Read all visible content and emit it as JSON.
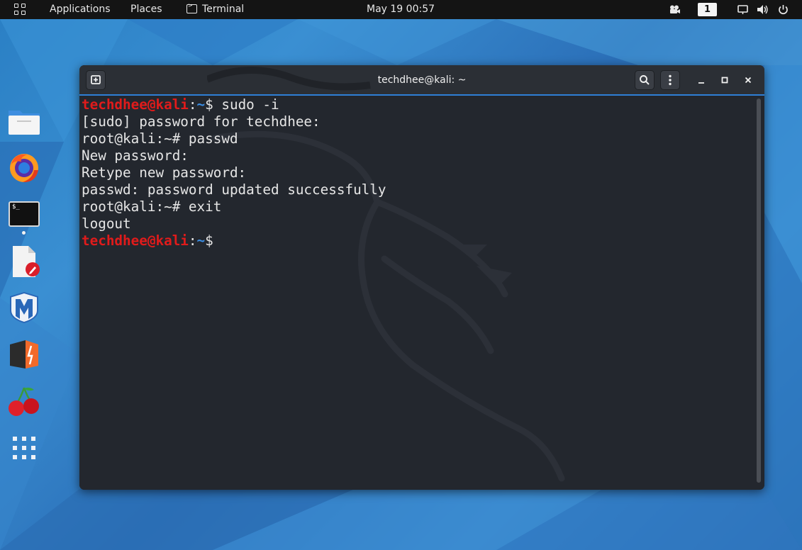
{
  "topbar": {
    "applications": "Applications",
    "places": "Places",
    "terminal": "Terminal",
    "datetime": "May 19  00:57",
    "workspace": "1"
  },
  "dock": {
    "items": [
      {
        "name": "files"
      },
      {
        "name": "firefox"
      },
      {
        "name": "terminal",
        "label": "$_"
      },
      {
        "name": "text-editor"
      },
      {
        "name": "metasploit"
      },
      {
        "name": "burpsuite"
      },
      {
        "name": "cherrytree"
      },
      {
        "name": "show-applications"
      }
    ]
  },
  "window": {
    "title": "techdhee@kali: ~"
  },
  "terminal": {
    "prompt_user": "techdhee@kali",
    "prompt_colon": ":",
    "prompt_path": "~",
    "prompt_symbol": "$",
    "lines": [
      {
        "type": "prompt",
        "cmd": " sudo -i"
      },
      {
        "type": "text",
        "text": "[sudo] password for techdhee:"
      },
      {
        "type": "text",
        "text": "root@kali:~# passwd"
      },
      {
        "type": "text",
        "text": "New password:"
      },
      {
        "type": "text",
        "text": "Retype new password:"
      },
      {
        "type": "text",
        "text": "passwd: password updated successfully"
      },
      {
        "type": "text",
        "text": "root@kali:~# exit"
      },
      {
        "type": "text",
        "text": "logout"
      },
      {
        "type": "prompt",
        "cmd": " "
      }
    ]
  },
  "colors": {
    "prompt_user": "#e01b1b",
    "prompt_path": "#3a8ee6",
    "terminal_bg": "#23272e",
    "accent": "#2f7fd6"
  }
}
